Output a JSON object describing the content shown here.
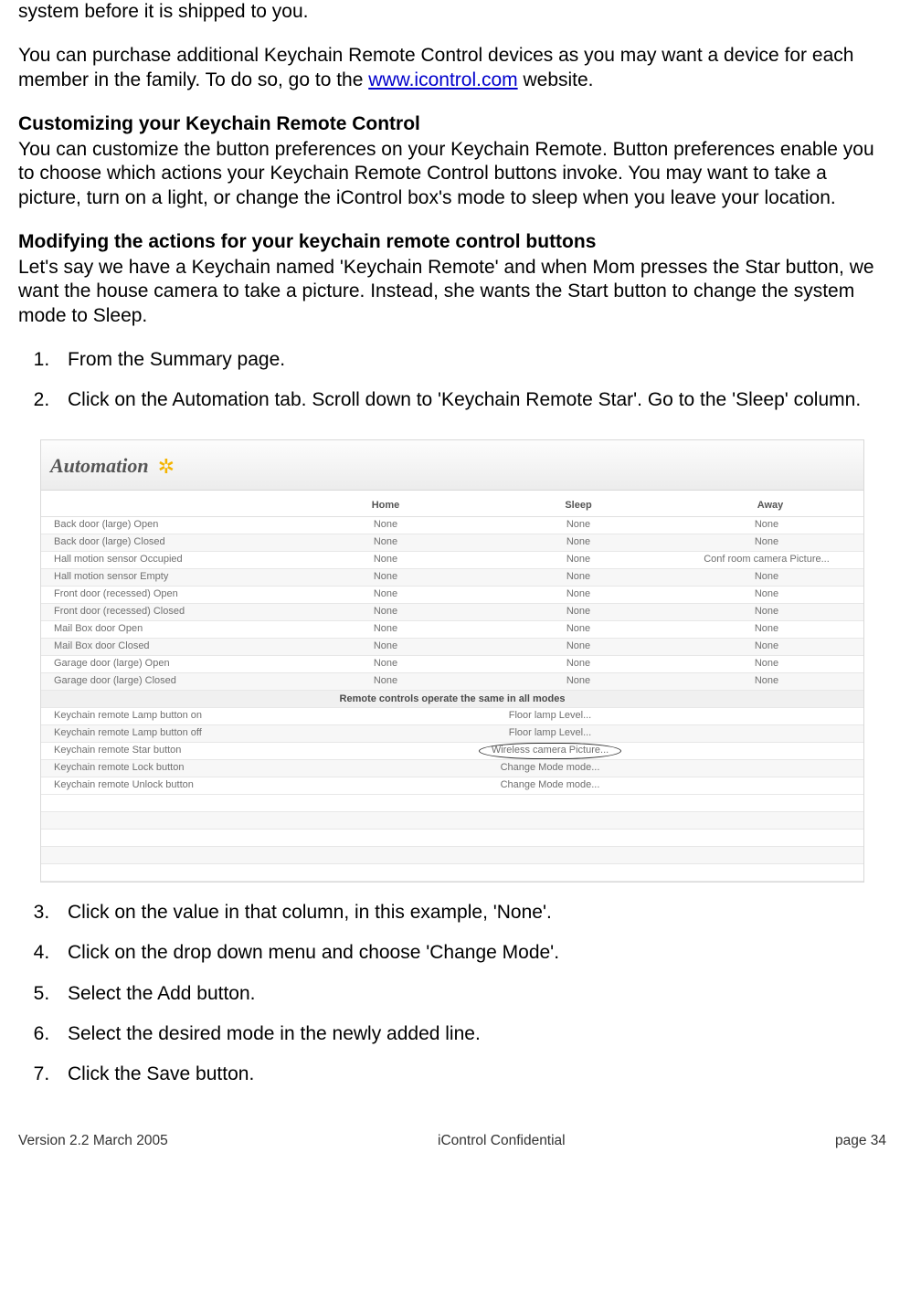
{
  "intro_line1": "system before it is shipped to you.",
  "purchase": {
    "pre": "You can purchase additional Keychain Remote Control devices as you may want a device for each member in the family.  To do so, go to the ",
    "link": "www.icontrol.com",
    "post": " website."
  },
  "sec1_heading": "Customizing your Keychain Remote Control",
  "sec1_body": "You can customize the button preferences on your Keychain Remote.  Button preferences enable you to choose which actions your Keychain Remote Control buttons invoke. You may want to take a picture, turn on a light, or change the iControl box's mode to sleep when you leave your location.",
  "sec2_heading": "Modifying the actions for your keychain remote control buttons",
  "sec2_body": "Let's say we have a Keychain named 'Keychain Remote' and when Mom presses the Star button, we want the house camera to take a picture.  Instead, she wants the Start button to change the system mode to Sleep.",
  "steps": [
    "From the Summary page.",
    "Click on the Automation tab.  Scroll down to 'Keychain Remote Star'. Go to the 'Sleep' column.",
    "Click on the value in that column, in this example, 'None'.",
    "Click on the drop down menu and choose 'Change Mode'.",
    "Select the Add button.",
    "Select the desired mode in the newly added line.",
    "Click the Save button."
  ],
  "shot": {
    "title": "Automation",
    "cols": [
      "",
      "Home",
      "Sleep",
      "Away"
    ],
    "rows": [
      {
        "label": "Back door (large) Open",
        "home": "None",
        "sleep": "None",
        "away": "None"
      },
      {
        "label": "Back door (large) Closed",
        "home": "None",
        "sleep": "None",
        "away": "None"
      },
      {
        "label": "Hall motion sensor Occupied",
        "home": "None",
        "sleep": "None",
        "away": "Conf room camera Picture..."
      },
      {
        "label": "Hall motion sensor Empty",
        "home": "None",
        "sleep": "None",
        "away": "None"
      },
      {
        "label": "Front door (recessed) Open",
        "home": "None",
        "sleep": "None",
        "away": "None"
      },
      {
        "label": "Front door (recessed) Closed",
        "home": "None",
        "sleep": "None",
        "away": "None"
      },
      {
        "label": "Mail Box door Open",
        "home": "None",
        "sleep": "None",
        "away": "None"
      },
      {
        "label": "Mail Box door Closed",
        "home": "None",
        "sleep": "None",
        "away": "None"
      },
      {
        "label": "Garage door (large) Open",
        "home": "None",
        "sleep": "None",
        "away": "None"
      },
      {
        "label": "Garage door (large) Closed",
        "home": "None",
        "sleep": "None",
        "away": "None"
      }
    ],
    "subhead": "Remote controls operate the same in all modes",
    "rows2": [
      {
        "label": "Keychain remote Lamp button on",
        "action": "Floor lamp Level...",
        "circle": false
      },
      {
        "label": "Keychain remote Lamp button off",
        "action": "Floor lamp Level...",
        "circle": false
      },
      {
        "label": "Keychain remote Star button",
        "action": "Wireless camera Picture...",
        "circle": true
      },
      {
        "label": "Keychain remote Lock button",
        "action": "Change Mode mode...",
        "circle": false
      },
      {
        "label": "Keychain remote Unlock button",
        "action": "Change Mode mode...",
        "circle": false
      }
    ]
  },
  "footer": {
    "left": "Version 2.2 March 2005",
    "mid": "iControl     Confidential",
    "right": "page 34"
  }
}
